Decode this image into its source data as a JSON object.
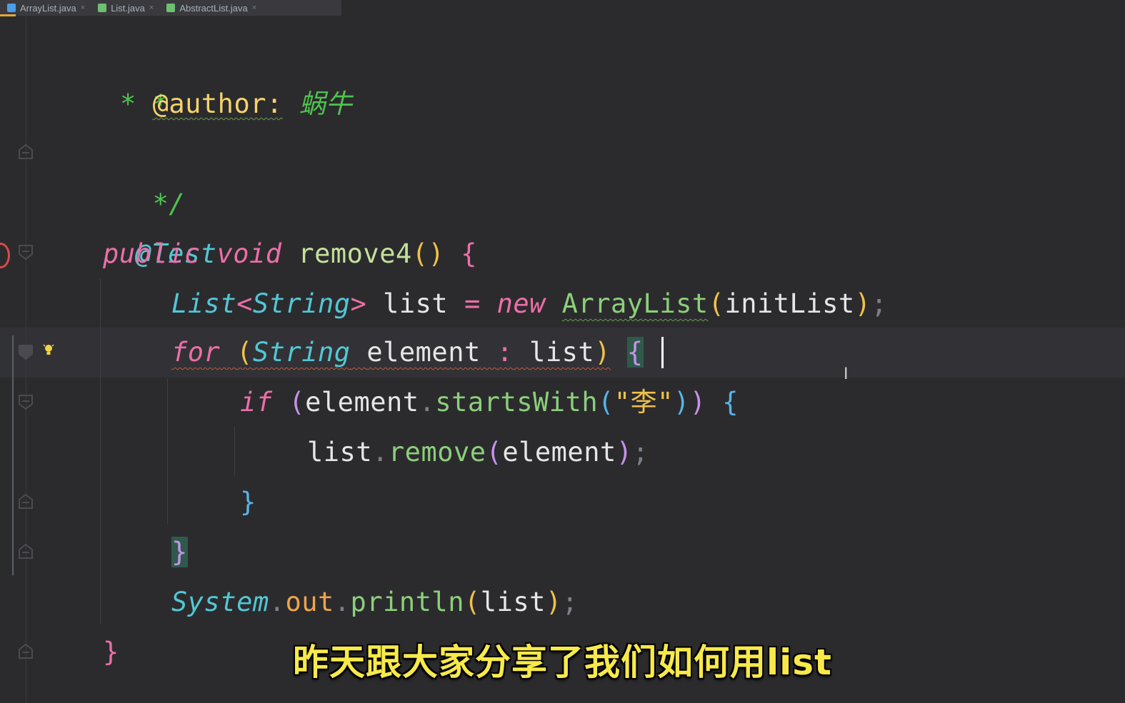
{
  "tabs": [
    {
      "label": "ArrayList.java",
      "icon": "java-class-icon",
      "color": "#4a9ee8"
    },
    {
      "label": "List.java",
      "icon": "interface-icon",
      "color": "#6fbf73"
    },
    {
      "label": "AbstractList.java",
      "icon": "abstract-class-icon",
      "color": "#6fbf73"
    }
  ],
  "editor": {
    "lines": {
      "l1_star": "*",
      "l2_star": "* ",
      "l2_tag": "@author:",
      "l2_name": "蜗牛",
      "l3_end": "*/",
      "l4_anno": "@Test",
      "l5_public": "public",
      "l5_void": "void",
      "l5_name": "remove4",
      "l6_list_type": "List",
      "l6_string": "String",
      "l6_var": "list",
      "l6_new": "new",
      "l6_class": "ArrayList",
      "l6_arg": "initList",
      "l7_for": "for",
      "l7_string": "String",
      "l7_var": "element",
      "l7_list": "list",
      "l8_if": "if",
      "l8_var": "element",
      "l8_method": "startsWith",
      "l8_str": "\"李\"",
      "l9_var": "list",
      "l9_method": "remove",
      "l9_arg": "element",
      "l12_system": "System",
      "l12_out": "out",
      "l12_method": "println",
      "l12_arg": "list"
    }
  },
  "subtitle": "昨天跟大家分享了我们如何用list",
  "colors": {
    "background": "#2b2b2e",
    "keyword": "#ec6fa7",
    "type": "#52c7d5",
    "comment": "#4ec44e",
    "subtitle": "#f7e94a"
  }
}
